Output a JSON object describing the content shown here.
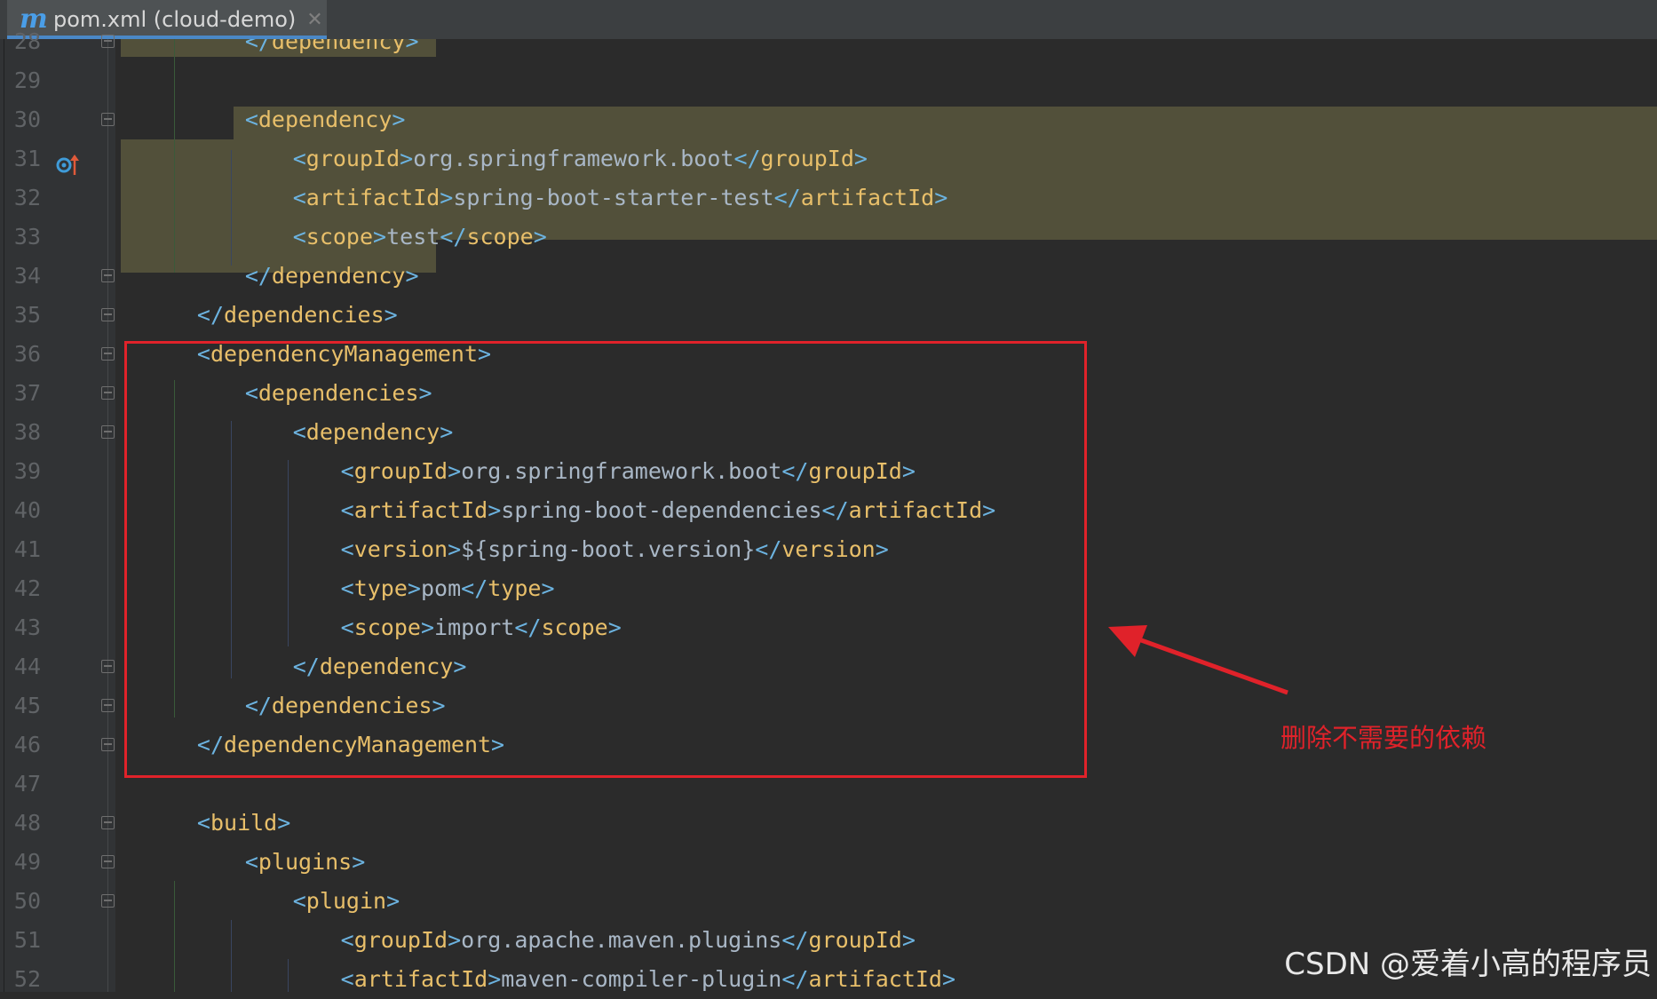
{
  "tab": {
    "icon": "maven-m-icon",
    "icon_glyph": "m",
    "title": "pom.xml (cloud-demo)",
    "close_glyph": "✕"
  },
  "line_numbers": [
    "28",
    "29",
    "30",
    "31",
    "32",
    "33",
    "34",
    "35",
    "36",
    "37",
    "38",
    "39",
    "40",
    "41",
    "42",
    "43",
    "44",
    "45",
    "46",
    "47",
    "48",
    "49",
    "50",
    "51",
    "52"
  ],
  "code": [
    {
      "indent": "        ",
      "parts": [
        [
          "b",
          "</"
        ],
        [
          "bt",
          "dependency"
        ],
        [
          "b",
          ">"
        ]
      ]
    },
    {
      "indent": "",
      "parts": []
    },
    {
      "indent": "        ",
      "parts": [
        [
          "b",
          "<"
        ],
        [
          "bt",
          "dependency"
        ],
        [
          "b",
          ">"
        ]
      ]
    },
    {
      "indent": "            ",
      "parts": [
        [
          "b",
          "<"
        ],
        [
          "bt",
          "groupId"
        ],
        [
          "b",
          ">"
        ],
        [
          "tx",
          "org.springframework.boot"
        ],
        [
          "b",
          "</"
        ],
        [
          "bt",
          "groupId"
        ],
        [
          "b",
          ">"
        ]
      ]
    },
    {
      "indent": "            ",
      "parts": [
        [
          "b",
          "<"
        ],
        [
          "bt",
          "artifactId"
        ],
        [
          "b",
          ">"
        ],
        [
          "tx",
          "spring-boot-starter-test"
        ],
        [
          "b",
          "</"
        ],
        [
          "bt",
          "artifactId"
        ],
        [
          "b",
          ">"
        ]
      ]
    },
    {
      "indent": "            ",
      "parts": [
        [
          "b",
          "<"
        ],
        [
          "bt",
          "scope"
        ],
        [
          "b",
          ">"
        ],
        [
          "tx",
          "test"
        ],
        [
          "b",
          "</"
        ],
        [
          "bt",
          "scope"
        ],
        [
          "b",
          ">"
        ]
      ]
    },
    {
      "indent": "        ",
      "parts": [
        [
          "b",
          "</"
        ],
        [
          "bt",
          "dependency"
        ],
        [
          "b",
          ">"
        ]
      ]
    },
    {
      "indent": "    ",
      "parts": [
        [
          "b",
          "</"
        ],
        [
          "bt",
          "dependencies"
        ],
        [
          "b",
          ">"
        ]
      ]
    },
    {
      "indent": "    ",
      "parts": [
        [
          "b",
          "<"
        ],
        [
          "bt",
          "dependencyManagement"
        ],
        [
          "b",
          ">"
        ]
      ]
    },
    {
      "indent": "        ",
      "parts": [
        [
          "b",
          "<"
        ],
        [
          "bt",
          "dependencies"
        ],
        [
          "b",
          ">"
        ]
      ]
    },
    {
      "indent": "            ",
      "parts": [
        [
          "b",
          "<"
        ],
        [
          "bt",
          "dependency"
        ],
        [
          "b",
          ">"
        ]
      ]
    },
    {
      "indent": "                ",
      "parts": [
        [
          "b",
          "<"
        ],
        [
          "bt",
          "groupId"
        ],
        [
          "b",
          ">"
        ],
        [
          "tx",
          "org.springframework.boot"
        ],
        [
          "b",
          "</"
        ],
        [
          "bt",
          "groupId"
        ],
        [
          "b",
          ">"
        ]
      ]
    },
    {
      "indent": "                ",
      "parts": [
        [
          "b",
          "<"
        ],
        [
          "bt",
          "artifactId"
        ],
        [
          "b",
          ">"
        ],
        [
          "tx",
          "spring-boot-dependencies"
        ],
        [
          "b",
          "</"
        ],
        [
          "bt",
          "artifactId"
        ],
        [
          "b",
          ">"
        ]
      ]
    },
    {
      "indent": "                ",
      "parts": [
        [
          "b",
          "<"
        ],
        [
          "bt",
          "version"
        ],
        [
          "b",
          ">"
        ],
        [
          "tx",
          "${spring-boot.version}"
        ],
        [
          "b",
          "</"
        ],
        [
          "bt",
          "version"
        ],
        [
          "b",
          ">"
        ]
      ]
    },
    {
      "indent": "                ",
      "parts": [
        [
          "b",
          "<"
        ],
        [
          "bt",
          "type"
        ],
        [
          "b",
          ">"
        ],
        [
          "tx",
          "pom"
        ],
        [
          "b",
          "</"
        ],
        [
          "bt",
          "type"
        ],
        [
          "b",
          ">"
        ]
      ]
    },
    {
      "indent": "                ",
      "parts": [
        [
          "b",
          "<"
        ],
        [
          "bt",
          "scope"
        ],
        [
          "b",
          ">"
        ],
        [
          "tx",
          "import"
        ],
        [
          "b",
          "</"
        ],
        [
          "bt",
          "scope"
        ],
        [
          "b",
          ">"
        ]
      ]
    },
    {
      "indent": "            ",
      "parts": [
        [
          "b",
          "</"
        ],
        [
          "bt",
          "dependency"
        ],
        [
          "b",
          ">"
        ]
      ]
    },
    {
      "indent": "        ",
      "parts": [
        [
          "b",
          "</"
        ],
        [
          "bt",
          "dependencies"
        ],
        [
          "b",
          ">"
        ]
      ]
    },
    {
      "indent": "    ",
      "parts": [
        [
          "b",
          "</"
        ],
        [
          "bt",
          "dependencyManagement"
        ],
        [
          "b",
          ">"
        ]
      ]
    },
    {
      "indent": "",
      "parts": []
    },
    {
      "indent": "    ",
      "parts": [
        [
          "b",
          "<"
        ],
        [
          "bt",
          "build"
        ],
        [
          "b",
          ">"
        ]
      ]
    },
    {
      "indent": "        ",
      "parts": [
        [
          "b",
          "<"
        ],
        [
          "bt",
          "plugins"
        ],
        [
          "b",
          ">"
        ]
      ]
    },
    {
      "indent": "            ",
      "parts": [
        [
          "b",
          "<"
        ],
        [
          "bt",
          "plugin"
        ],
        [
          "b",
          ">"
        ]
      ]
    },
    {
      "indent": "                ",
      "parts": [
        [
          "b",
          "<"
        ],
        [
          "bt",
          "groupId"
        ],
        [
          "b",
          ">"
        ],
        [
          "tx",
          "org.apache.maven.plugins"
        ],
        [
          "b",
          "</"
        ],
        [
          "bt",
          "groupId"
        ],
        [
          "b",
          ">"
        ]
      ]
    },
    {
      "indent": "                ",
      "parts": [
        [
          "b",
          "<"
        ],
        [
          "bt",
          "artifactId"
        ],
        [
          "b",
          ">"
        ],
        [
          "tx",
          "maven-compiler-plugin"
        ],
        [
          "b",
          "</"
        ],
        [
          "bt",
          "artifactId"
        ],
        [
          "b",
          ">"
        ]
      ]
    }
  ],
  "fold_markers_on_lines": [
    28,
    30,
    34,
    35,
    36,
    37,
    38,
    44,
    45,
    46,
    48,
    49,
    50
  ],
  "gutter_icon": "implementation-up-arrow-icon",
  "annotation": {
    "label": "删除不需要的依赖",
    "color": "#e0222a"
  },
  "watermark": "CSDN @爱着小高的程序员",
  "colors": {
    "background": "#2b2b2b",
    "tag_bracket": "#6cb3e0",
    "tag_name": "#e8bf6a",
    "text": "#a9b7c6",
    "highlight": "#52503a"
  }
}
